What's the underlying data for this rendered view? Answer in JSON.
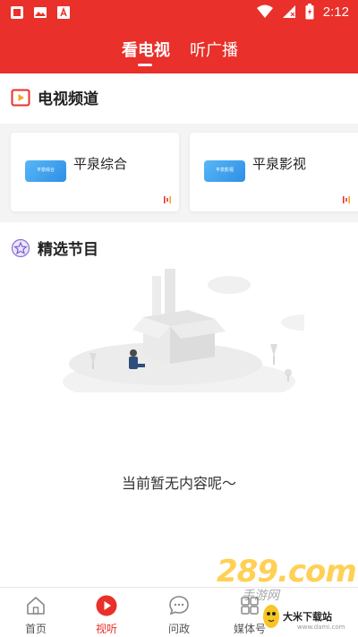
{
  "status_bar": {
    "time": "2:12"
  },
  "header": {
    "tabs": [
      {
        "label": "看电视",
        "active": true
      },
      {
        "label": "听广播",
        "active": false
      }
    ],
    "accent_color": "#e9302a"
  },
  "tv_section": {
    "title": "电视频道",
    "channels": [
      {
        "name": "平泉综合",
        "logo_text": "平泉综合"
      },
      {
        "name": "平泉影视",
        "logo_text": "平泉影视"
      }
    ]
  },
  "featured_section": {
    "title": "精选节目",
    "empty_message": "当前暂无内容呢～"
  },
  "bottom_nav": {
    "items": [
      {
        "label": "首页",
        "icon": "home-icon",
        "active": false
      },
      {
        "label": "视听",
        "icon": "play-icon",
        "active": true
      },
      {
        "label": "问政",
        "icon": "chat-icon",
        "active": false
      },
      {
        "label": "媒体号",
        "icon": "media-icon",
        "active": false
      }
    ]
  },
  "watermark": {
    "big": "289.com",
    "sub": "手游网",
    "brand": "大米下载站",
    "url": "www.dami.com"
  }
}
